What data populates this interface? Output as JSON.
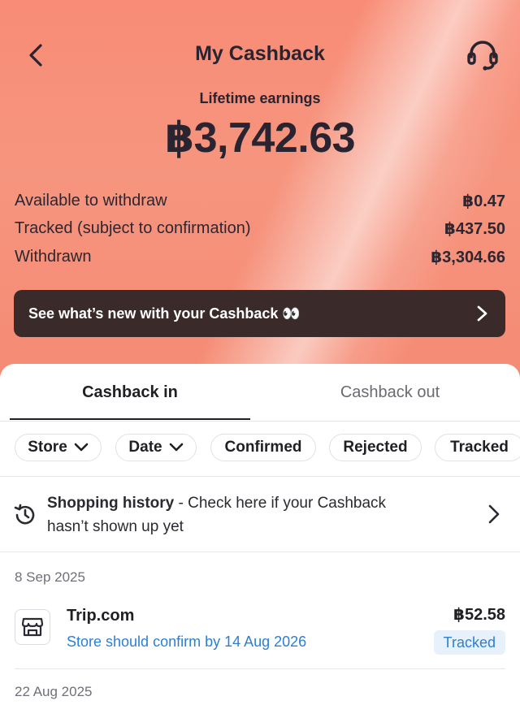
{
  "header": {
    "title": "My Cashback",
    "back_icon": "chevron-left-icon",
    "support_icon": "headset-icon"
  },
  "earnings": {
    "lifetime_label": "Lifetime earnings",
    "lifetime_value": "฿3,742.63",
    "rows": [
      {
        "label": "Available to withdraw",
        "value": "฿0.47"
      },
      {
        "label": "Tracked (subject to confirmation)",
        "value": "฿437.50"
      },
      {
        "label": "Withdrawn",
        "value": "฿3,304.66"
      }
    ]
  },
  "banner": {
    "text": "See what’s new with your Cashback 👀"
  },
  "tabs": [
    {
      "label": "Cashback in",
      "active": true
    },
    {
      "label": "Cashback out",
      "active": false
    }
  ],
  "filters": [
    {
      "label": "Store",
      "dropdown": true
    },
    {
      "label": "Date",
      "dropdown": true
    },
    {
      "label": "Confirmed",
      "dropdown": false
    },
    {
      "label": "Rejected",
      "dropdown": false
    },
    {
      "label": "Tracked",
      "dropdown": false
    }
  ],
  "history": {
    "title": "Shopping history",
    "text": " - Check here if your Cashback",
    "text2": "hasn’t shown up yet"
  },
  "transactions": [
    {
      "date": "8 Sep 2025",
      "store": "Trip.com",
      "note": "Store should confirm by 14 Aug 2026",
      "amount": "฿52.58",
      "status": "Tracked"
    }
  ],
  "next_date": "22 Aug 2025",
  "colors": {
    "accent_blue": "#2b7fd4",
    "hero": "#f88c76",
    "banner_bg": "#3a2a2a"
  }
}
